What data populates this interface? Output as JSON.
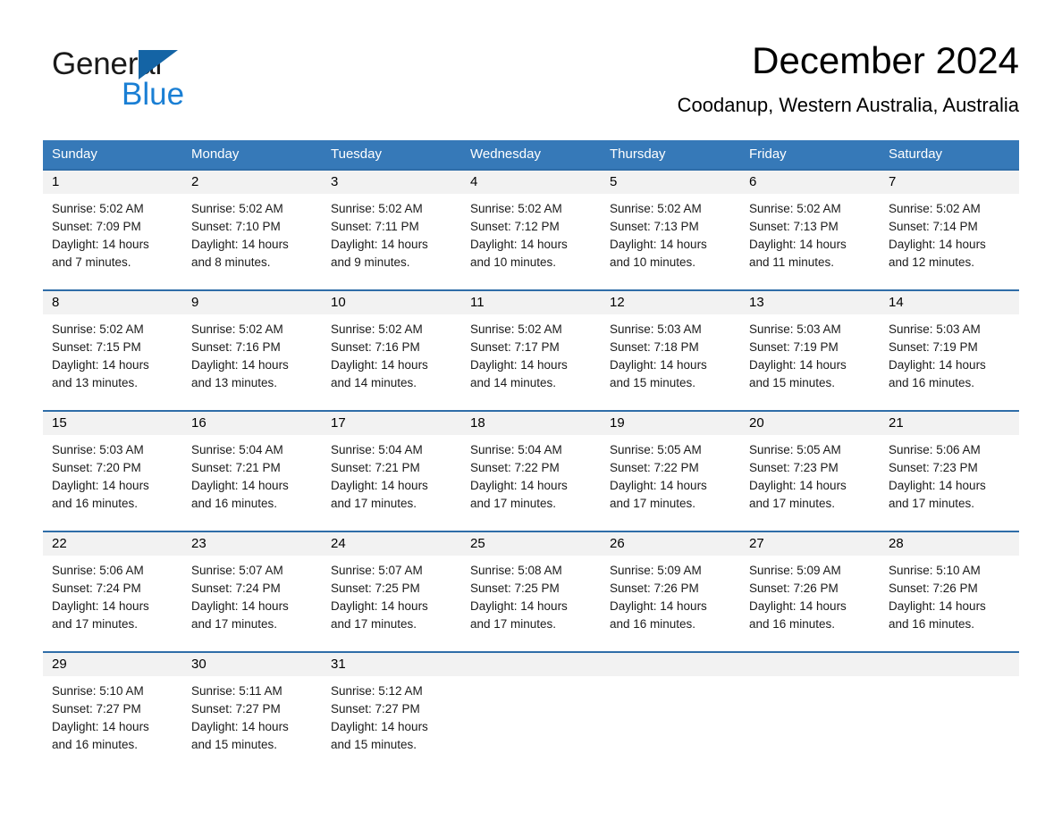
{
  "brand": {
    "name_part1": "General",
    "name_part2": "Blue",
    "triangle_color": "#1464a5",
    "blue_text_color": "#1a7fd4"
  },
  "header": {
    "title": "December 2024",
    "subtitle": "Coodanup, Western Australia, Australia"
  },
  "theme": {
    "header_blue": "#3679b8",
    "row_divider_blue": "#2f6da8",
    "day_number_bg": "#f2f2f2"
  },
  "weekdays": [
    "Sunday",
    "Monday",
    "Tuesday",
    "Wednesday",
    "Thursday",
    "Friday",
    "Saturday"
  ],
  "weeks": [
    [
      {
        "day": "1",
        "sunrise": "Sunrise: 5:02 AM",
        "sunset": "Sunset: 7:09 PM",
        "daylight_line1": "Daylight: 14 hours",
        "daylight_line2": "and 7 minutes."
      },
      {
        "day": "2",
        "sunrise": "Sunrise: 5:02 AM",
        "sunset": "Sunset: 7:10 PM",
        "daylight_line1": "Daylight: 14 hours",
        "daylight_line2": "and 8 minutes."
      },
      {
        "day": "3",
        "sunrise": "Sunrise: 5:02 AM",
        "sunset": "Sunset: 7:11 PM",
        "daylight_line1": "Daylight: 14 hours",
        "daylight_line2": "and 9 minutes."
      },
      {
        "day": "4",
        "sunrise": "Sunrise: 5:02 AM",
        "sunset": "Sunset: 7:12 PM",
        "daylight_line1": "Daylight: 14 hours",
        "daylight_line2": "and 10 minutes."
      },
      {
        "day": "5",
        "sunrise": "Sunrise: 5:02 AM",
        "sunset": "Sunset: 7:13 PM",
        "daylight_line1": "Daylight: 14 hours",
        "daylight_line2": "and 10 minutes."
      },
      {
        "day": "6",
        "sunrise": "Sunrise: 5:02 AM",
        "sunset": "Sunset: 7:13 PM",
        "daylight_line1": "Daylight: 14 hours",
        "daylight_line2": "and 11 minutes."
      },
      {
        "day": "7",
        "sunrise": "Sunrise: 5:02 AM",
        "sunset": "Sunset: 7:14 PM",
        "daylight_line1": "Daylight: 14 hours",
        "daylight_line2": "and 12 minutes."
      }
    ],
    [
      {
        "day": "8",
        "sunrise": "Sunrise: 5:02 AM",
        "sunset": "Sunset: 7:15 PM",
        "daylight_line1": "Daylight: 14 hours",
        "daylight_line2": "and 13 minutes."
      },
      {
        "day": "9",
        "sunrise": "Sunrise: 5:02 AM",
        "sunset": "Sunset: 7:16 PM",
        "daylight_line1": "Daylight: 14 hours",
        "daylight_line2": "and 13 minutes."
      },
      {
        "day": "10",
        "sunrise": "Sunrise: 5:02 AM",
        "sunset": "Sunset: 7:16 PM",
        "daylight_line1": "Daylight: 14 hours",
        "daylight_line2": "and 14 minutes."
      },
      {
        "day": "11",
        "sunrise": "Sunrise: 5:02 AM",
        "sunset": "Sunset: 7:17 PM",
        "daylight_line1": "Daylight: 14 hours",
        "daylight_line2": "and 14 minutes."
      },
      {
        "day": "12",
        "sunrise": "Sunrise: 5:03 AM",
        "sunset": "Sunset: 7:18 PM",
        "daylight_line1": "Daylight: 14 hours",
        "daylight_line2": "and 15 minutes."
      },
      {
        "day": "13",
        "sunrise": "Sunrise: 5:03 AM",
        "sunset": "Sunset: 7:19 PM",
        "daylight_line1": "Daylight: 14 hours",
        "daylight_line2": "and 15 minutes."
      },
      {
        "day": "14",
        "sunrise": "Sunrise: 5:03 AM",
        "sunset": "Sunset: 7:19 PM",
        "daylight_line1": "Daylight: 14 hours",
        "daylight_line2": "and 16 minutes."
      }
    ],
    [
      {
        "day": "15",
        "sunrise": "Sunrise: 5:03 AM",
        "sunset": "Sunset: 7:20 PM",
        "daylight_line1": "Daylight: 14 hours",
        "daylight_line2": "and 16 minutes."
      },
      {
        "day": "16",
        "sunrise": "Sunrise: 5:04 AM",
        "sunset": "Sunset: 7:21 PM",
        "daylight_line1": "Daylight: 14 hours",
        "daylight_line2": "and 16 minutes."
      },
      {
        "day": "17",
        "sunrise": "Sunrise: 5:04 AM",
        "sunset": "Sunset: 7:21 PM",
        "daylight_line1": "Daylight: 14 hours",
        "daylight_line2": "and 17 minutes."
      },
      {
        "day": "18",
        "sunrise": "Sunrise: 5:04 AM",
        "sunset": "Sunset: 7:22 PM",
        "daylight_line1": "Daylight: 14 hours",
        "daylight_line2": "and 17 minutes."
      },
      {
        "day": "19",
        "sunrise": "Sunrise: 5:05 AM",
        "sunset": "Sunset: 7:22 PM",
        "daylight_line1": "Daylight: 14 hours",
        "daylight_line2": "and 17 minutes."
      },
      {
        "day": "20",
        "sunrise": "Sunrise: 5:05 AM",
        "sunset": "Sunset: 7:23 PM",
        "daylight_line1": "Daylight: 14 hours",
        "daylight_line2": "and 17 minutes."
      },
      {
        "day": "21",
        "sunrise": "Sunrise: 5:06 AM",
        "sunset": "Sunset: 7:23 PM",
        "daylight_line1": "Daylight: 14 hours",
        "daylight_line2": "and 17 minutes."
      }
    ],
    [
      {
        "day": "22",
        "sunrise": "Sunrise: 5:06 AM",
        "sunset": "Sunset: 7:24 PM",
        "daylight_line1": "Daylight: 14 hours",
        "daylight_line2": "and 17 minutes."
      },
      {
        "day": "23",
        "sunrise": "Sunrise: 5:07 AM",
        "sunset": "Sunset: 7:24 PM",
        "daylight_line1": "Daylight: 14 hours",
        "daylight_line2": "and 17 minutes."
      },
      {
        "day": "24",
        "sunrise": "Sunrise: 5:07 AM",
        "sunset": "Sunset: 7:25 PM",
        "daylight_line1": "Daylight: 14 hours",
        "daylight_line2": "and 17 minutes."
      },
      {
        "day": "25",
        "sunrise": "Sunrise: 5:08 AM",
        "sunset": "Sunset: 7:25 PM",
        "daylight_line1": "Daylight: 14 hours",
        "daylight_line2": "and 17 minutes."
      },
      {
        "day": "26",
        "sunrise": "Sunrise: 5:09 AM",
        "sunset": "Sunset: 7:26 PM",
        "daylight_line1": "Daylight: 14 hours",
        "daylight_line2": "and 16 minutes."
      },
      {
        "day": "27",
        "sunrise": "Sunrise: 5:09 AM",
        "sunset": "Sunset: 7:26 PM",
        "daylight_line1": "Daylight: 14 hours",
        "daylight_line2": "and 16 minutes."
      },
      {
        "day": "28",
        "sunrise": "Sunrise: 5:10 AM",
        "sunset": "Sunset: 7:26 PM",
        "daylight_line1": "Daylight: 14 hours",
        "daylight_line2": "and 16 minutes."
      }
    ],
    [
      {
        "day": "29",
        "sunrise": "Sunrise: 5:10 AM",
        "sunset": "Sunset: 7:27 PM",
        "daylight_line1": "Daylight: 14 hours",
        "daylight_line2": "and 16 minutes."
      },
      {
        "day": "30",
        "sunrise": "Sunrise: 5:11 AM",
        "sunset": "Sunset: 7:27 PM",
        "daylight_line1": "Daylight: 14 hours",
        "daylight_line2": "and 15 minutes."
      },
      {
        "day": "31",
        "sunrise": "Sunrise: 5:12 AM",
        "sunset": "Sunset: 7:27 PM",
        "daylight_line1": "Daylight: 14 hours",
        "daylight_line2": "and 15 minutes."
      },
      {
        "day": "",
        "sunrise": "",
        "sunset": "",
        "daylight_line1": "",
        "daylight_line2": ""
      },
      {
        "day": "",
        "sunrise": "",
        "sunset": "",
        "daylight_line1": "",
        "daylight_line2": ""
      },
      {
        "day": "",
        "sunrise": "",
        "sunset": "",
        "daylight_line1": "",
        "daylight_line2": ""
      },
      {
        "day": "",
        "sunrise": "",
        "sunset": "",
        "daylight_line1": "",
        "daylight_line2": ""
      }
    ]
  ]
}
